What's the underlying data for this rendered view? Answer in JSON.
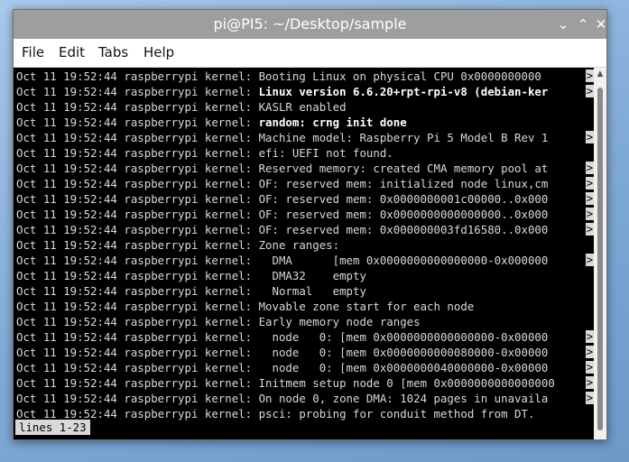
{
  "window": {
    "title": "pi@PI5: ~/Desktop/sample",
    "minimize_glyph": "⌄",
    "maximize_glyph": "⌃",
    "close_glyph": "✕"
  },
  "menu": {
    "file": "File",
    "edit": "Edit",
    "tabs": "Tabs",
    "help": "Help"
  },
  "log": {
    "prefix": "Oct 11 19:52:44 raspberrypi kernel: ",
    "truncation_marker": ">",
    "lines": [
      {
        "msg": "Booting Linux on physical CPU 0x0000000000",
        "bold": false,
        "truncated": true
      },
      {
        "msg": "Linux version 6.6.20+rpt-rpi-v8 (debian-ker",
        "bold": true,
        "truncated": true
      },
      {
        "msg": "KASLR enabled",
        "bold": false,
        "truncated": false
      },
      {
        "msg": "random: crng init done",
        "bold": true,
        "truncated": false
      },
      {
        "msg": "Machine model: Raspberry Pi 5 Model B Rev 1",
        "bold": false,
        "truncated": true
      },
      {
        "msg": "efi: UEFI not found.",
        "bold": false,
        "truncated": false
      },
      {
        "msg": "Reserved memory: created CMA memory pool at",
        "bold": false,
        "truncated": true
      },
      {
        "msg": "OF: reserved mem: initialized node linux,cm",
        "bold": false,
        "truncated": true
      },
      {
        "msg": "OF: reserved mem: 0x0000000001c00000..0x000",
        "bold": false,
        "truncated": true
      },
      {
        "msg": "OF: reserved mem: 0x0000000000000000..0x000",
        "bold": false,
        "truncated": true
      },
      {
        "msg": "OF: reserved mem: 0x000000003fd16580..0x000",
        "bold": false,
        "truncated": true
      },
      {
        "msg": "Zone ranges:",
        "bold": false,
        "truncated": false
      },
      {
        "msg": "  DMA      [mem 0x0000000000000000-0x000000",
        "bold": false,
        "truncated": true
      },
      {
        "msg": "  DMA32    empty",
        "bold": false,
        "truncated": false
      },
      {
        "msg": "  Normal   empty",
        "bold": false,
        "truncated": false
      },
      {
        "msg": "Movable zone start for each node",
        "bold": false,
        "truncated": false
      },
      {
        "msg": "Early memory node ranges",
        "bold": false,
        "truncated": false
      },
      {
        "msg": "  node   0: [mem 0x0000000000000000-0x00000",
        "bold": false,
        "truncated": true
      },
      {
        "msg": "  node   0: [mem 0x0000000000080000-0x00000",
        "bold": false,
        "truncated": true
      },
      {
        "msg": "  node   0: [mem 0x0000000040000000-0x00000",
        "bold": false,
        "truncated": true
      },
      {
        "msg": "Initmem setup node 0 [mem 0x0000000000000000",
        "bold": false,
        "truncated": true
      },
      {
        "msg": "On node 0, zone DMA: 1024 pages in unavaila",
        "bold": false,
        "truncated": true
      },
      {
        "msg": "psci: probing for conduit method from DT.",
        "bold": false,
        "truncated": false
      }
    ]
  },
  "status": {
    "text": "lines 1-23"
  }
}
